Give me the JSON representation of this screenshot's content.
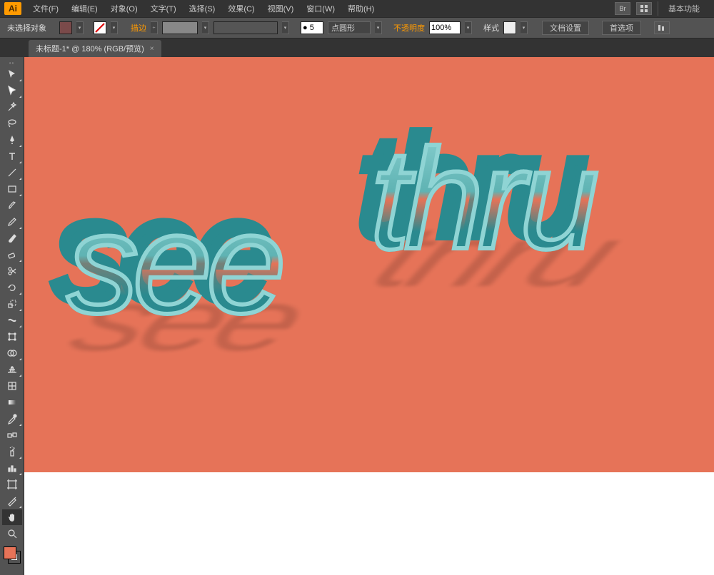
{
  "brand": "Ai",
  "menu": {
    "file": "文件(F)",
    "edit": "编辑(E)",
    "object": "对象(O)",
    "type": "文字(T)",
    "select": "选择(S)",
    "effect": "效果(C)",
    "view": "视图(V)",
    "window": "窗口(W)",
    "help": "帮助(H)"
  },
  "menubar_right": {
    "br": "Br",
    "workspace": "基本功能"
  },
  "control": {
    "selection": "未选择对象",
    "fill_color": "#7a4a4a",
    "stroke_label": "描边",
    "stroke_weight_icon": "●",
    "stroke_value": "5",
    "brush_label": "点圆形",
    "opacity_label": "不透明度",
    "opacity_value": "100%",
    "style_label": "样式",
    "doc_setup": "文档设置",
    "prefs": "首选项"
  },
  "tab": {
    "title": "未标题-1* @ 180% (RGB/预览)",
    "close": "×"
  },
  "artwork": {
    "word1": "see",
    "word2": "thru"
  },
  "tools": [
    "selection",
    "direct-selection",
    "magic-wand",
    "lasso",
    "pen",
    "type",
    "line",
    "rectangle",
    "paintbrush",
    "pencil",
    "blob-brush",
    "eraser",
    "scissors",
    "rotate",
    "scale",
    "width",
    "free-transform",
    "shape-builder",
    "perspective",
    "mesh",
    "gradient",
    "eyedropper",
    "blend",
    "symbol-sprayer",
    "column-graph",
    "artboard",
    "slice",
    "hand",
    "zoom"
  ]
}
